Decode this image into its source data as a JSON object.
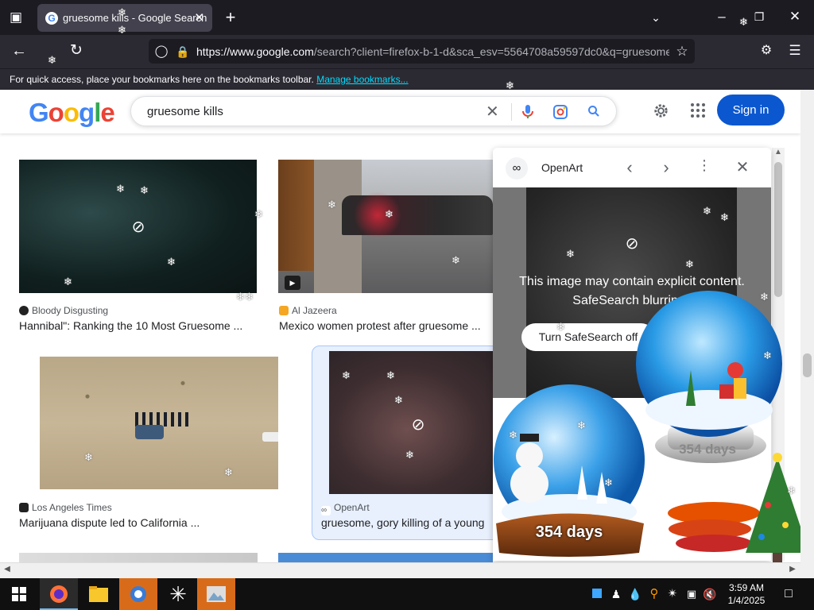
{
  "browser": {
    "tab_title": "gruesome kills - Google Search",
    "tab_favicon": "G",
    "url_host": "https://www.google.com",
    "url_rest": "/search?client=firefox-b-1-d&sca_esv=5564708a59597dc0&q=gruesome",
    "bookmarks_text": "For quick access, place your bookmarks here on the bookmarks toolbar.",
    "bookmarks_link": "Manage bookmarks..."
  },
  "google": {
    "logo": [
      "G",
      "o",
      "o",
      "g",
      "l",
      "e"
    ],
    "logo_colors": [
      "#4285f4",
      "#ea4335",
      "#fbbc05",
      "#4285f4",
      "#34a853",
      "#ea4335"
    ],
    "query": "gruesome kills",
    "signin": "Sign in"
  },
  "results": [
    {
      "source": "Bloody Disgusting",
      "caption": "Hannibal\": Ranking the 10 Most Gruesome ...",
      "icon_color": "#222222"
    },
    {
      "source": "Al Jazeera",
      "caption": "Mexico women protest after gruesome ...",
      "icon_color": "#f5a623"
    },
    {
      "source": "Los Angeles Times",
      "caption": "Marijuana dispute led to California ...",
      "icon_color": "#222222"
    },
    {
      "source": "OpenArt",
      "caption": "gruesome, gory killing of a young",
      "icon_color": "#555555"
    }
  ],
  "panel": {
    "source": "OpenArt",
    "warning_line1": "This image may contain explicit content.",
    "warning_line2": "SafeSearch blurring i",
    "button": "Turn SafeSearch off"
  },
  "decorations": {
    "globe1_text": "354 days",
    "globe2_text": "354 days"
  },
  "taskbar": {
    "time": "3:59 AM",
    "date": "1/4/2025"
  }
}
